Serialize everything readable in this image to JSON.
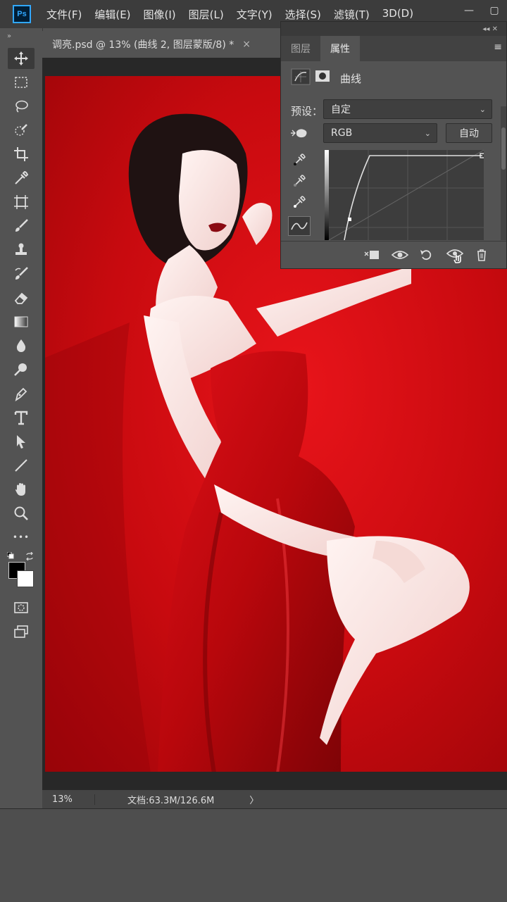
{
  "app": {
    "logo": "Ps",
    "menu": [
      "文件(F)",
      "编辑(E)",
      "图像(I)",
      "图层(L)",
      "文字(Y)",
      "选择(S)",
      "滤镜(T)",
      "3D(D)"
    ],
    "window_controls": [
      "—",
      "▢"
    ]
  },
  "document": {
    "tab_title": "调亮.psd @ 13% (曲线 2, 图层蒙版/8) *",
    "close": "×"
  },
  "status": {
    "zoom": "13%",
    "doc_size": "文档:63.3M/126.6M",
    "arrow": "〉"
  },
  "toolbar": {
    "grip": "»",
    "tools": [
      "move-icon",
      "marquee-icon",
      "lasso-icon",
      "quick-select-icon",
      "crop-icon",
      "eyedropper-icon",
      "frame-icon",
      "brush-icon",
      "stamp-icon",
      "history-brush-icon",
      "eraser-icon",
      "gradient-icon",
      "blur-drop-icon",
      "dodge-icon",
      "pen-icon",
      "type-icon",
      "path-select-icon",
      "line-icon",
      "hand-icon",
      "zoom-icon",
      "more-icon"
    ],
    "more_label": "•••"
  },
  "properties": {
    "panel_top_arrows": "◂◂ ✕",
    "tabs": [
      "图层",
      "属性"
    ],
    "active_tab": 1,
    "menu_icon": "≡",
    "title": "曲线",
    "preset_label": "预设：",
    "preset_value": "自定",
    "channel_value": "RGB",
    "auto_label": "自动",
    "caret": "⌄"
  },
  "colors": {
    "accent": "#31a8ff",
    "menubar": "#3c3c3c",
    "panel": "#535353",
    "photo_red": "#d90d12"
  }
}
